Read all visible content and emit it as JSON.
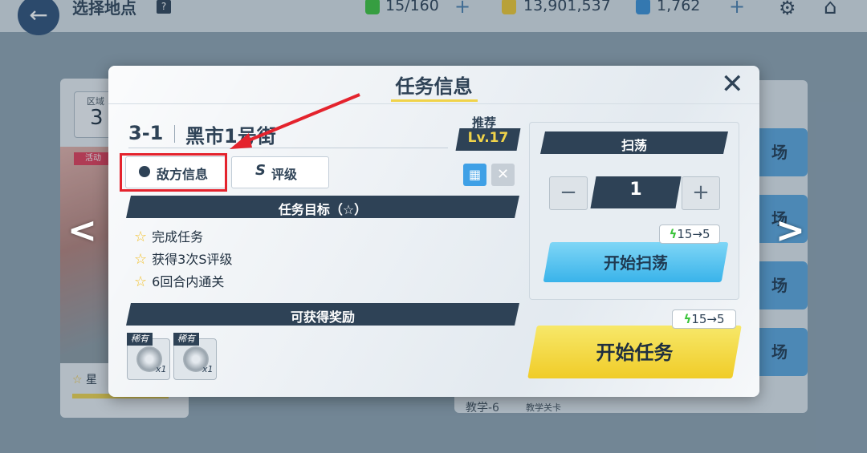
{
  "background": {
    "header": {
      "title": "选择地点",
      "help": "?",
      "energy": "15/160",
      "credits": "13,901,537",
      "gems": "1,762",
      "plus": "+"
    },
    "zone": {
      "label": "区域",
      "number": "3"
    },
    "event_tag": "活动",
    "star_text": "星",
    "right_cards": [
      "场",
      "场",
      "场",
      "场"
    ],
    "row_label": "教学-6",
    "row_label2": "教学关卡"
  },
  "dialog": {
    "title": "任务信息",
    "close": "✕",
    "stage_id": "3-1",
    "stage_name": "黑市1号街",
    "recommend_label": "推荐",
    "recommend_level": "Lv.17",
    "tabs": {
      "enemy": "敌方信息",
      "rating_icon": "S",
      "rating": "评级"
    },
    "objectives_header": "任务目标（☆）",
    "objectives": [
      "完成任务",
      "获得3次S评级",
      "6回合内通关"
    ],
    "rewards_header": "可获得奖励",
    "rewards": [
      {
        "badge": "稀有",
        "count": "x1"
      },
      {
        "badge": "稀有",
        "count": "x1"
      }
    ],
    "sweep": {
      "header": "扫荡",
      "minus": "−",
      "quantity": "1",
      "plus": "+",
      "cost": "15→5",
      "button": "开始扫荡"
    },
    "start": {
      "cost": "15→5",
      "button": "开始任务"
    }
  },
  "colors": {
    "accent_dark": "#2e4256",
    "highlight_red": "#e4232d",
    "yellow": "#f0d34a",
    "blue": "#39b3ea"
  }
}
